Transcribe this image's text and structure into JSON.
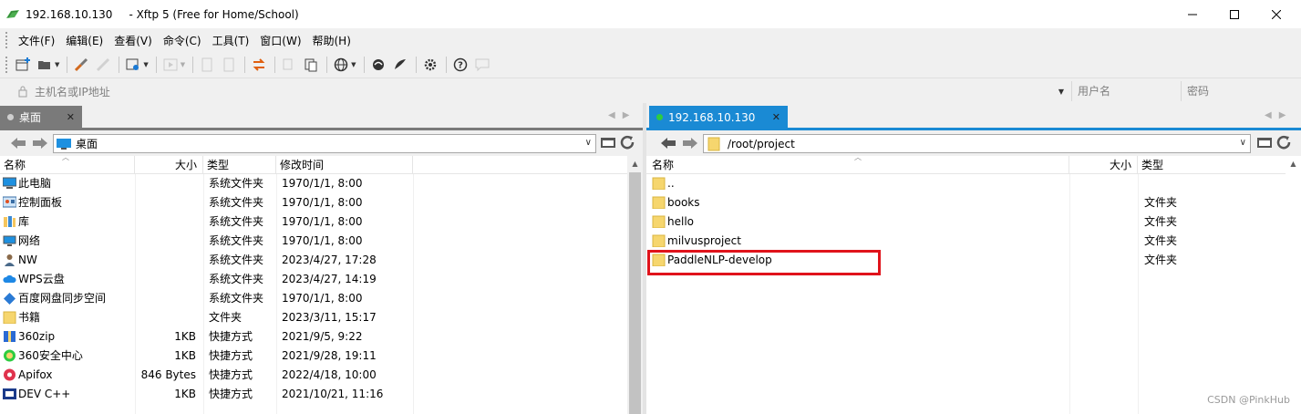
{
  "window": {
    "title_host": "192.168.10.130",
    "title_app": "- Xftp 5 (Free for Home/School)",
    "minimize": "—",
    "maximize": "☐",
    "close": "✕"
  },
  "menu": {
    "items": [
      "文件(F)",
      "编辑(E)",
      "查看(V)",
      "命令(C)",
      "工具(T)",
      "窗口(W)",
      "帮助(H)"
    ]
  },
  "toolbar": {
    "icons": [
      "new-session-icon",
      "open-folder-icon",
      "connect-icon",
      "disconnect-icon",
      "properties-icon",
      "transfer-icon",
      "refresh-icon",
      "copy-icon",
      "paste-icon",
      "sync-icon",
      "globe-icon",
      "shell-icon",
      "xshell-icon",
      "settings-icon",
      "help-icon",
      "chat-icon"
    ]
  },
  "address": {
    "host_placeholder": "主机名或IP地址",
    "user_placeholder": "用户名",
    "pass_placeholder": "密码"
  },
  "left": {
    "tab_label": "桌面",
    "tab_close": "✕",
    "path": "桌面",
    "columns": [
      "名称",
      "大小",
      "类型",
      "修改时间"
    ],
    "rows": [
      {
        "icon": "computer-icon",
        "name": "此电脑",
        "size": "",
        "type": "系统文件夹",
        "modified": "1970/1/1, 8:00"
      },
      {
        "icon": "control-panel-icon",
        "name": "控制面板",
        "size": "",
        "type": "系统文件夹",
        "modified": "1970/1/1, 8:00"
      },
      {
        "icon": "library-icon",
        "name": "库",
        "size": "",
        "type": "系统文件夹",
        "modified": "1970/1/1, 8:00"
      },
      {
        "icon": "network-icon",
        "name": "网络",
        "size": "",
        "type": "系统文件夹",
        "modified": "1970/1/1, 8:00"
      },
      {
        "icon": "user-icon",
        "name": "NW",
        "size": "",
        "type": "系统文件夹",
        "modified": "2023/4/27, 17:28"
      },
      {
        "icon": "cloud-icon",
        "name": "WPS云盘",
        "size": "",
        "type": "系统文件夹",
        "modified": "2023/4/27, 14:19"
      },
      {
        "icon": "sync-drive-icon",
        "name": "百度网盘同步空间",
        "size": "",
        "type": "系统文件夹",
        "modified": "1970/1/1, 8:00"
      },
      {
        "icon": "folder-icon",
        "name": "书籍",
        "size": "",
        "type": "文件夹",
        "modified": "2023/3/11, 15:17"
      },
      {
        "icon": "zip-app-icon",
        "name": "360zip",
        "size": "1KB",
        "type": "快捷方式",
        "modified": "2021/9/5, 9:22"
      },
      {
        "icon": "security-app-icon",
        "name": "360安全中心",
        "size": "1KB",
        "type": "快捷方式",
        "modified": "2021/9/28, 19:11"
      },
      {
        "icon": "apifox-app-icon",
        "name": "Apifox",
        "size": "846 Bytes",
        "type": "快捷方式",
        "modified": "2022/4/18, 10:00"
      },
      {
        "icon": "devcpp-app-icon",
        "name": "DEV C++",
        "size": "1KB",
        "type": "快捷方式",
        "modified": "2021/10/21, 11:16"
      }
    ]
  },
  "right": {
    "tab_label": "192.168.10.130",
    "tab_close": "✕",
    "path": "/root/project",
    "columns": [
      "名称",
      "大小",
      "类型"
    ],
    "rows": [
      {
        "icon": "folder-icon",
        "name": "..",
        "size": "",
        "type": ""
      },
      {
        "icon": "folder-icon",
        "name": "books",
        "size": "",
        "type": "文件夹"
      },
      {
        "icon": "folder-icon",
        "name": "hello",
        "size": "",
        "type": "文件夹"
      },
      {
        "icon": "folder-icon",
        "name": "milvusproject",
        "size": "",
        "type": "文件夹"
      },
      {
        "icon": "folder-icon",
        "name": "PaddleNLP-develop",
        "size": "",
        "type": "文件夹"
      }
    ]
  },
  "watermark": "CSDN @PinkHub",
  "colors": {
    "active_tab": "#1a8ad4",
    "inactive_tab": "#7a7a7a",
    "highlight": "#e0131b",
    "folder": "#f6d66e",
    "connected_dot": "#2ecc40"
  }
}
